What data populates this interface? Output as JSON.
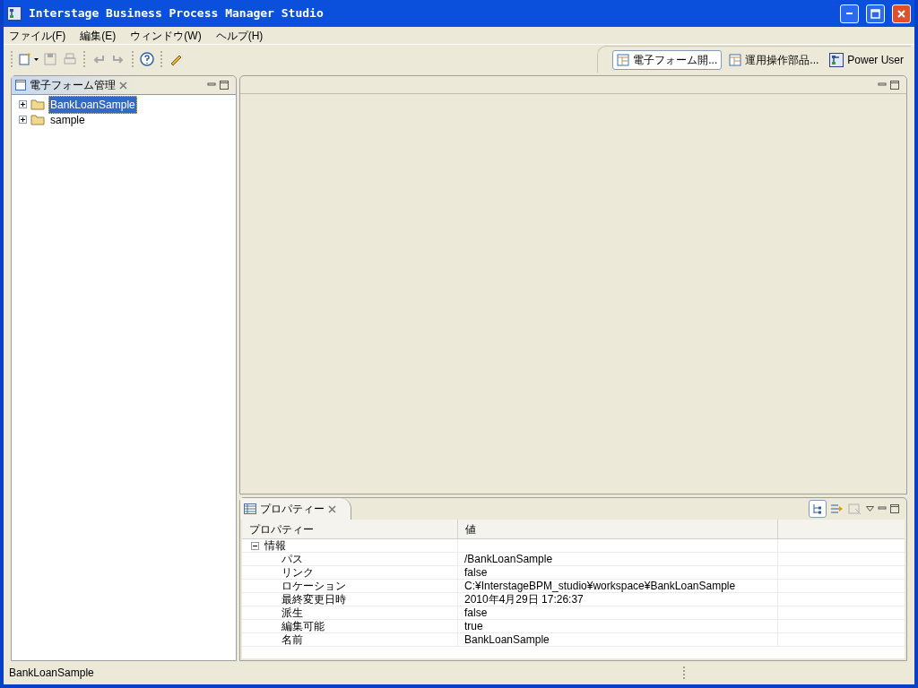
{
  "window": {
    "title": "Interstage Business Process Manager Studio"
  },
  "menu": [
    "ファイル(F)",
    "編集(E)",
    "ウィンドウ(W)",
    "ヘルプ(H)"
  ],
  "toolbar": [
    {
      "kind": "new",
      "disabled": false
    },
    {
      "kind": "save",
      "disabled": true
    },
    {
      "kind": "print",
      "disabled": true
    },
    {
      "kind": "undo",
      "disabled": true
    },
    {
      "kind": "redo",
      "disabled": true
    },
    {
      "kind": "help",
      "disabled": false
    },
    {
      "kind": "tool",
      "disabled": false
    }
  ],
  "perspectives": [
    {
      "label": "電子フォーム開...",
      "kind": "table",
      "selected": true
    },
    {
      "label": "運用操作部品...",
      "kind": "table",
      "selected": false
    },
    {
      "label": "Power User",
      "kind": "user",
      "selected": false
    }
  ],
  "navigator": {
    "title": "電子フォーム管理",
    "items": [
      {
        "label": "BankLoanSample",
        "expanded": false,
        "selected": true
      },
      {
        "label": "sample",
        "expanded": false,
        "selected": false
      }
    ]
  },
  "properties": {
    "title": "プロパティー",
    "columns": [
      "プロパティー",
      "値"
    ],
    "group": {
      "label": "情報",
      "expanded": true,
      "rows": [
        {
          "name": "パス",
          "value": "/BankLoanSample"
        },
        {
          "name": "リンク",
          "value": "false"
        },
        {
          "name": "ロケーション",
          "value": "C:¥InterstageBPM_studio¥workspace¥BankLoanSample"
        },
        {
          "name": "最終変更日時",
          "value": "2010年4月29日 17:26:37"
        },
        {
          "name": "派生",
          "value": "false"
        },
        {
          "name": "編集可能",
          "value": "true"
        },
        {
          "name": "名前",
          "value": "BankLoanSample"
        }
      ]
    }
  },
  "status_bar": {
    "text": "BankLoanSample"
  }
}
